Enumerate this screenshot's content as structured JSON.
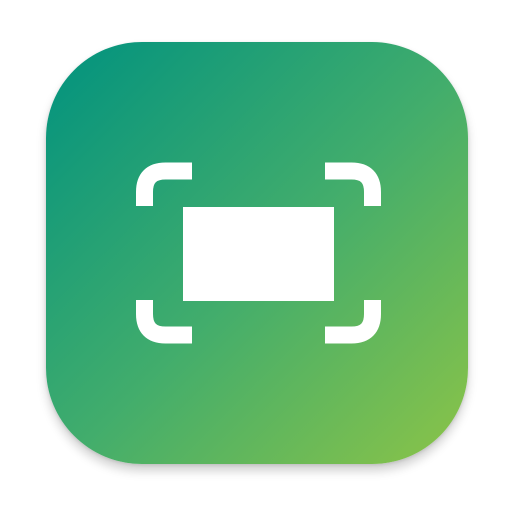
{
  "app_icon": {
    "icon_name": "screenshot-capture-icon",
    "colors": {
      "gradient_start": "#00927f",
      "gradient_mid": "#42ad6c",
      "gradient_end": "#8cc447",
      "glyph": "#ffffff"
    }
  }
}
